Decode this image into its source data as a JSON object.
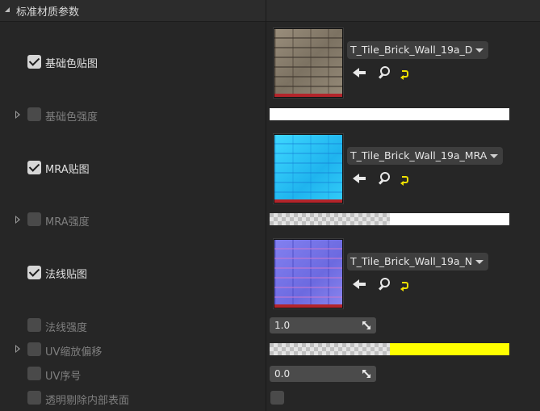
{
  "header": {
    "title": "标准材质参数"
  },
  "params": {
    "base_color_map": {
      "label": "基础色贴图",
      "texture": "T_Tile_Brick_Wall_19a_D"
    },
    "base_color_strength": {
      "label": "基础色强度"
    },
    "mra_map": {
      "label": "MRA贴图",
      "texture": "T_Tile_Brick_Wall_19a_MRA"
    },
    "mra_strength": {
      "label": "MRA强度"
    },
    "normal_map": {
      "label": "法线贴图",
      "texture": "T_Tile_Brick_Wall_19a_N"
    },
    "normal_strength": {
      "label": "法线强度",
      "value": "1.0"
    },
    "uv_scale_offset": {
      "label": "UV缩放偏移"
    },
    "uv_index": {
      "label": "UV序号",
      "value": "0.0"
    },
    "masked_opacity": {
      "label": "透明剔除内部表面"
    }
  },
  "colors": {
    "base_color_strength_fill": "#ffffff",
    "mra_strength_fill": "#ffffff",
    "uv_scale_offset_fill": "#ffff00",
    "mra_strength_alpha_checker_fraction": 0.5,
    "uv_scale_offset_alpha_checker_fraction": 0.5
  },
  "icons": {
    "use_selected": "arrow-left-icon",
    "browse": "search-icon",
    "reset": "reset-to-default-icon",
    "expand": "expand-arrow-icon"
  }
}
